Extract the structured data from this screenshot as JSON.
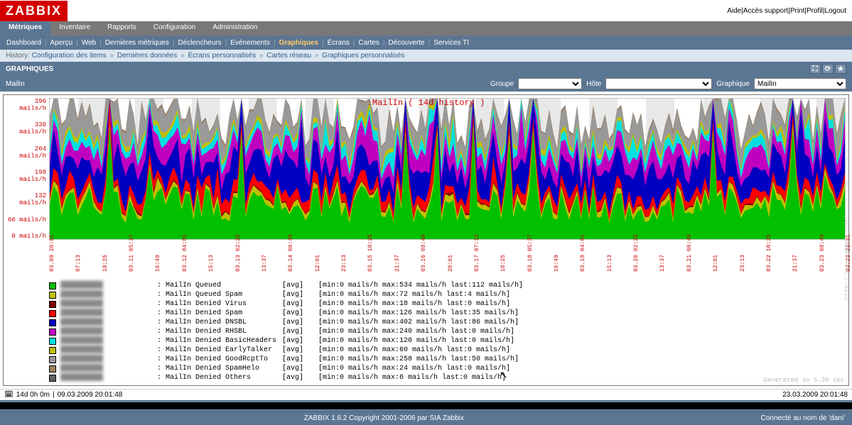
{
  "logo": "ZABBIX",
  "top_links": [
    "Aide",
    "Accès support",
    "Print",
    "Profil",
    "Logout"
  ],
  "main_nav": {
    "items": [
      "Métriques",
      "Inventaire",
      "Rapports",
      "Configuration",
      "Administration"
    ],
    "active": 0
  },
  "sub_nav": {
    "items": [
      "Dashboard",
      "Aperçu",
      "Web",
      "Dernières métriques",
      "Déclencheurs",
      "Evénements",
      "Graphiques",
      "Écrans",
      "Cartes",
      "Découverte",
      "Services TI"
    ],
    "active": 6
  },
  "history": {
    "label": "History:",
    "items": [
      "Configuration des items",
      "Dernières données",
      "Écrans personnalisés",
      "Cartes réseau",
      "Graphiques personnalisés"
    ]
  },
  "section_title": "GRAPHIQUES",
  "filter": {
    "title": "MailIn",
    "groupe_label": "Groupe",
    "hote_label": "Hôte",
    "graphique_label": "Graphique",
    "groupe_value": "",
    "hote_value": "",
    "graphique_value": "MailIn"
  },
  "graph_header": ":MailIn ( 14d history )",
  "generated_note": "Generated in 5.38 sec",
  "watermark": "http://www.zabbix.com/",
  "time_left": {
    "icon_label": "14d 0h 0m",
    "timestamp": "09.03.2009 20:01:48"
  },
  "time_right": "23.03.2009 20:01:48",
  "footer": {
    "copyright": "ZABBIX 1.6.2 Copyright 2001-2006 par SIA Zabbix",
    "login": "Connecté au nom de 'dani'"
  },
  "chart_data": {
    "type": "area",
    "stacked": true,
    "title": "MailIn ( 14d history )",
    "ylabel": "mails/h",
    "ylim": [
      0,
      396
    ],
    "yticks": [
      0,
      66,
      132,
      198,
      264,
      330,
      396
    ],
    "ytick_labels": [
      "0 mails/h",
      "66 mails/h",
      "132 mails/h",
      "198 mails/h",
      "264 mails/h",
      "330 mails/h",
      "396 mails/h"
    ],
    "x_ticks": [
      "03.09 20:01",
      "07:13",
      "18:25",
      "03.11 05:37",
      "16:49",
      "03.12 04:01",
      "15:13",
      "03.13 02:25",
      "13:37",
      "03.14 00:49",
      "12:01",
      "23:13",
      "03.15 10:25",
      "21:37",
      "03.16 08:49",
      "20:01",
      "03.17 07:13",
      "18:25",
      "03.18 05:37",
      "16:49",
      "03.19 04:01",
      "15:13",
      "03.20 02:25",
      "13:37",
      "03.21 00:49",
      "12:01",
      "23:13",
      "03.22 10:25",
      "21:37",
      "03.23 08:49",
      "03.23 20:01"
    ],
    "series": [
      {
        "name": "MailIn Queued",
        "color": "#00c000",
        "agg": "avg",
        "min": 0,
        "max": 534,
        "last": 112
      },
      {
        "name": "MailIn Queued Spam",
        "color": "#c0c000",
        "agg": "avg",
        "min": 0,
        "max": 72,
        "last": 4
      },
      {
        "name": "MailIn Denied Virus",
        "color": "#800000",
        "agg": "avg",
        "min": 0,
        "max": 18,
        "last": 0
      },
      {
        "name": "MailIn Denied Spam",
        "color": "#ff0000",
        "agg": "avg",
        "min": 0,
        "max": 126,
        "last": 35
      },
      {
        "name": "MailIn Denied DNSBL",
        "color": "#0000c0",
        "agg": "avg",
        "min": 0,
        "max": 402,
        "last": 86
      },
      {
        "name": "MailIn Denied RHSBL",
        "color": "#c000c0",
        "agg": "avg",
        "min": 0,
        "max": 240,
        "last": 0
      },
      {
        "name": "MailIn Denied BasicHeaders",
        "color": "#00e0e0",
        "agg": "avg",
        "min": 0,
        "max": 120,
        "last": 0
      },
      {
        "name": "MailIn Denied EarlyTalker",
        "color": "#c0c000",
        "agg": "avg",
        "min": 0,
        "max": 60,
        "last": 0
      },
      {
        "name": "MailIn Denied GoodRcptTo",
        "color": "#999999",
        "agg": "avg",
        "min": 0,
        "max": 258,
        "last": 50
      },
      {
        "name": "MailIn Denied SpamHelo",
        "color": "#a08060",
        "agg": "avg",
        "min": 0,
        "max": 24,
        "last": 0
      },
      {
        "name": "MailIn Denied Others",
        "color": "#606060",
        "agg": "avg",
        "min": 0,
        "max": 6,
        "last": 0
      }
    ]
  }
}
